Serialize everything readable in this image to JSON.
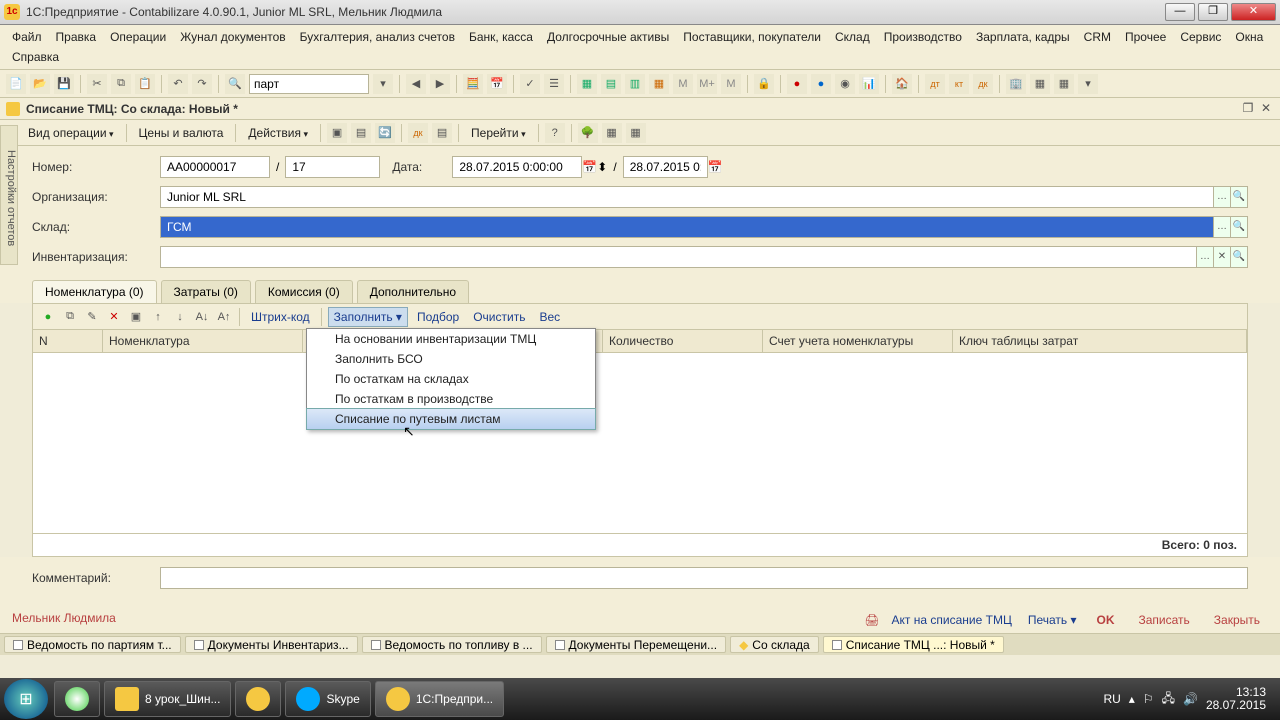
{
  "window": {
    "title": "1С:Предприятие - Contabilizare 4.0.90.1, Junior ML SRL, Мельник Людмила"
  },
  "menu": [
    "Файл",
    "Правка",
    "Операции",
    "Жунал документов",
    "Бухгалтерия, анализ счетов",
    "Банк, касса",
    "Долгосрочные активы",
    "Поставщики, покупатели",
    "Склад",
    "Производство",
    "Зарплата, кадры",
    "CRM",
    "Прочее",
    "Сервис",
    "Окна",
    "Справка"
  ],
  "toolbar_search": "парт",
  "doc": {
    "title": "Списание ТМЦ: Со склада: Новый *"
  },
  "doc_toolbar": {
    "operation": "Вид операции",
    "prices": "Цены и валюта",
    "actions": "Действия",
    "goto": "Перейти"
  },
  "form": {
    "number_label": "Номер:",
    "number": "АА00000017",
    "slash": "/",
    "subnum": "17",
    "date_label": "Дата:",
    "date": "28.07.2015 0:00:00",
    "date2": "28.07.2015 0:",
    "org_label": "Организация:",
    "org": "Junior ML SRL",
    "sklad_label": "Склад:",
    "sklad": "ГСМ",
    "inv_label": "Инвентаризация:",
    "inv": "",
    "comment_label": "Комментарий:",
    "comment": ""
  },
  "tabs": [
    "Номенклатура (0)",
    "Затраты (0)",
    "Комиссия (0)",
    "Дополнительно"
  ],
  "grid_toolbar": {
    "barcode": "Штрих-код",
    "fill": "Заполнить",
    "pick": "Подбор",
    "clear": "Очистить",
    "weight": "Вес"
  },
  "columns": [
    "N",
    "Номенклатура",
    "",
    "Количество",
    "Счет учета номенклатуры",
    "Ключ таблицы затрат"
  ],
  "grid_footer": "Всего: 0 поз.",
  "dropdown": [
    "На основании инвентаризации ТМЦ",
    "Заполнить БСО",
    "По остаткам на складах",
    "По остаткам в производстве",
    "Списание по путевым листам"
  ],
  "footer": {
    "user": "Мельник Людмила",
    "print_doc": "Акт на списание ТМЦ",
    "print": "Печать",
    "ok": "OK",
    "save": "Записать",
    "close": "Закрыть"
  },
  "window_tabs": [
    "Ведомость по партиям т...",
    "Документы Инвентариз...",
    "Ведомость по топливу в ...",
    "Документы Перемещени...",
    "Со склада",
    "Списание ТМЦ ...: Новый *"
  ],
  "taskbar": {
    "items": [
      "8 урок_Шин...",
      "",
      "Skype",
      "1С:Предпри..."
    ],
    "lang": "RU",
    "time": "13:13",
    "date": "28.07.2015"
  }
}
